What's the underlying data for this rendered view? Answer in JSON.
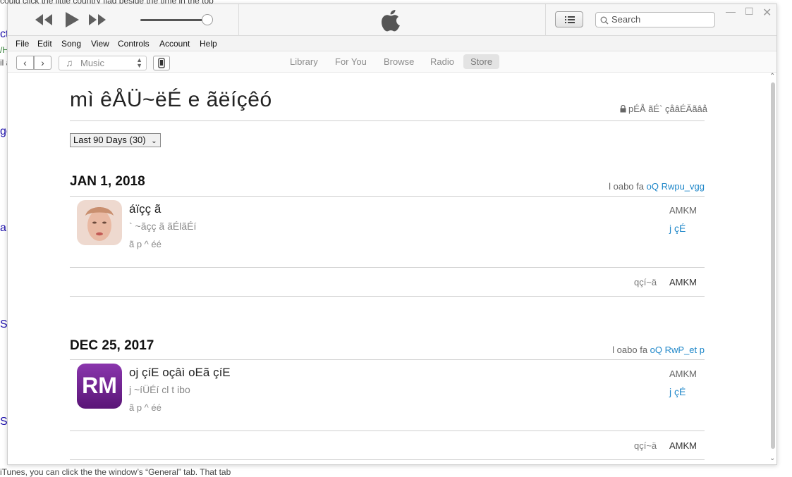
{
  "background": {
    "top_text": "could click the little country flag beside the time in the top",
    "bottom_text": "iTunes, you can click the the window’s “General” tab. That tab",
    "frag_a": "cto",
    "frag_b": "/H",
    "frag_c": "il a",
    "frag_d": "ge",
    "frag_e": "ar",
    "frag_f": "St",
    "frag_g": "Si"
  },
  "transport": {
    "rewind_icon": "rewind-icon",
    "play_icon": "play-icon",
    "forward_icon": "fast-forward-icon",
    "volume_level": 0.9
  },
  "search": {
    "placeholder": "Search"
  },
  "menu": [
    "File",
    "Edit",
    "Song",
    "View",
    "Controls",
    "Account",
    "Help"
  ],
  "nav": {
    "media_label": "Music",
    "tabs": [
      "Library",
      "For You",
      "Browse",
      "Radio",
      "Store"
    ],
    "active_tab": "Store"
  },
  "page": {
    "title": "mì êÅÜ~ëÉ e ãëíçêó",
    "session_note": "pÉÅ ãÉ` çåâÉÄãâå",
    "period": "Last 90 Days (30)"
  },
  "orders": [
    {
      "date": "JAN 1, 2018",
      "order_label": "l oabo fa",
      "order_value": "oQ Rwpu_vgg",
      "item_title": "áïçç ã",
      "item_sub": "` ~ãçç ã ãÉlãÉí",
      "item_meta": "ã p ^ éé",
      "price": "AMKM",
      "report_label": "j çÉ",
      "total_label": "qçí~ä",
      "total_value": "AMKM"
    },
    {
      "date": "DEC 25, 2017",
      "order_label": "l oabo fa",
      "order_value": "oQ RwP_et p",
      "item_title": "oj çíE oçâì oEã çíE",
      "item_sub": "j ~íÜÉí  cl t  ibo",
      "item_meta": "ã p ^ éé",
      "price": "AMKM",
      "report_label": "j çÉ",
      "total_label": "qçí~ä",
      "total_value": "AMKM",
      "icon_text": "RM"
    }
  ],
  "colors": {
    "link": "#1f87c9",
    "rm_icon": "#6a1f8c"
  }
}
